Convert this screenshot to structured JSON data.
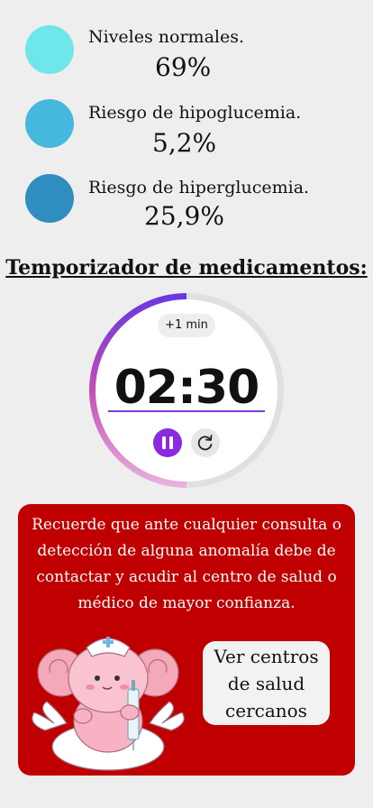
{
  "stats": [
    {
      "label": "Niveles normales.",
      "value": "69%",
      "color": "#6ee6ea"
    },
    {
      "label": "Riesgo de hipoglucemia.",
      "value": "5,2%",
      "color": "#47b8dd"
    },
    {
      "label": "Riesgo de hiperglucemia.",
      "value": "25,9%",
      "color": "#2f8dc0"
    }
  ],
  "timer": {
    "title": "Temporizador de medicamentos:",
    "add_label": "+1 min",
    "time": "02:30",
    "progress_fraction": 0.5,
    "accent": "#8a2be2",
    "pause_icon": "pause-icon",
    "reset_icon": "reset-icon"
  },
  "notice": {
    "text": "Recuerde que ante cualquier consulta o detección de alguna anomalía debe de contactar y acudir al centro de salud o médico de mayor confianza.",
    "button_label": "Ver centros de salud cercanos",
    "background": "#c00000"
  }
}
